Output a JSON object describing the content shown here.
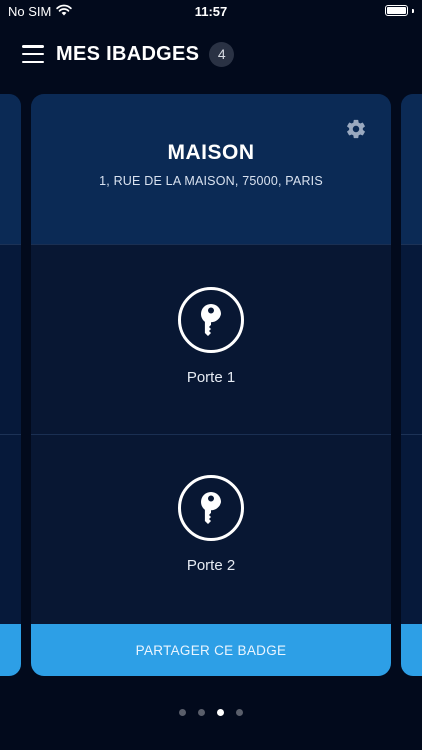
{
  "status_bar": {
    "carrier": "No SIM",
    "time": "11:57",
    "icons": [
      "wifi-icon",
      "battery-icon"
    ]
  },
  "header": {
    "title": "MES IBADGES",
    "badge_count": "4",
    "menu_icon": "hamburger-menu-icon"
  },
  "badge": {
    "name": "MAISON",
    "address": "1, RUE DE LA MAISON, 75000, PARIS",
    "settings_icon": "gear-icon",
    "doors": [
      {
        "label": "Porte 1",
        "icon": "key-icon"
      },
      {
        "label": "Porte 2",
        "icon": "key-icon"
      }
    ],
    "share_label": "PARTAGER CE BADGE"
  },
  "pagination": {
    "total": 4,
    "active_index": 2
  },
  "colors": {
    "background": "#020a1c",
    "card_header": "#0b2a55",
    "card_body": "#081733",
    "accent": "#2d9fe6"
  }
}
